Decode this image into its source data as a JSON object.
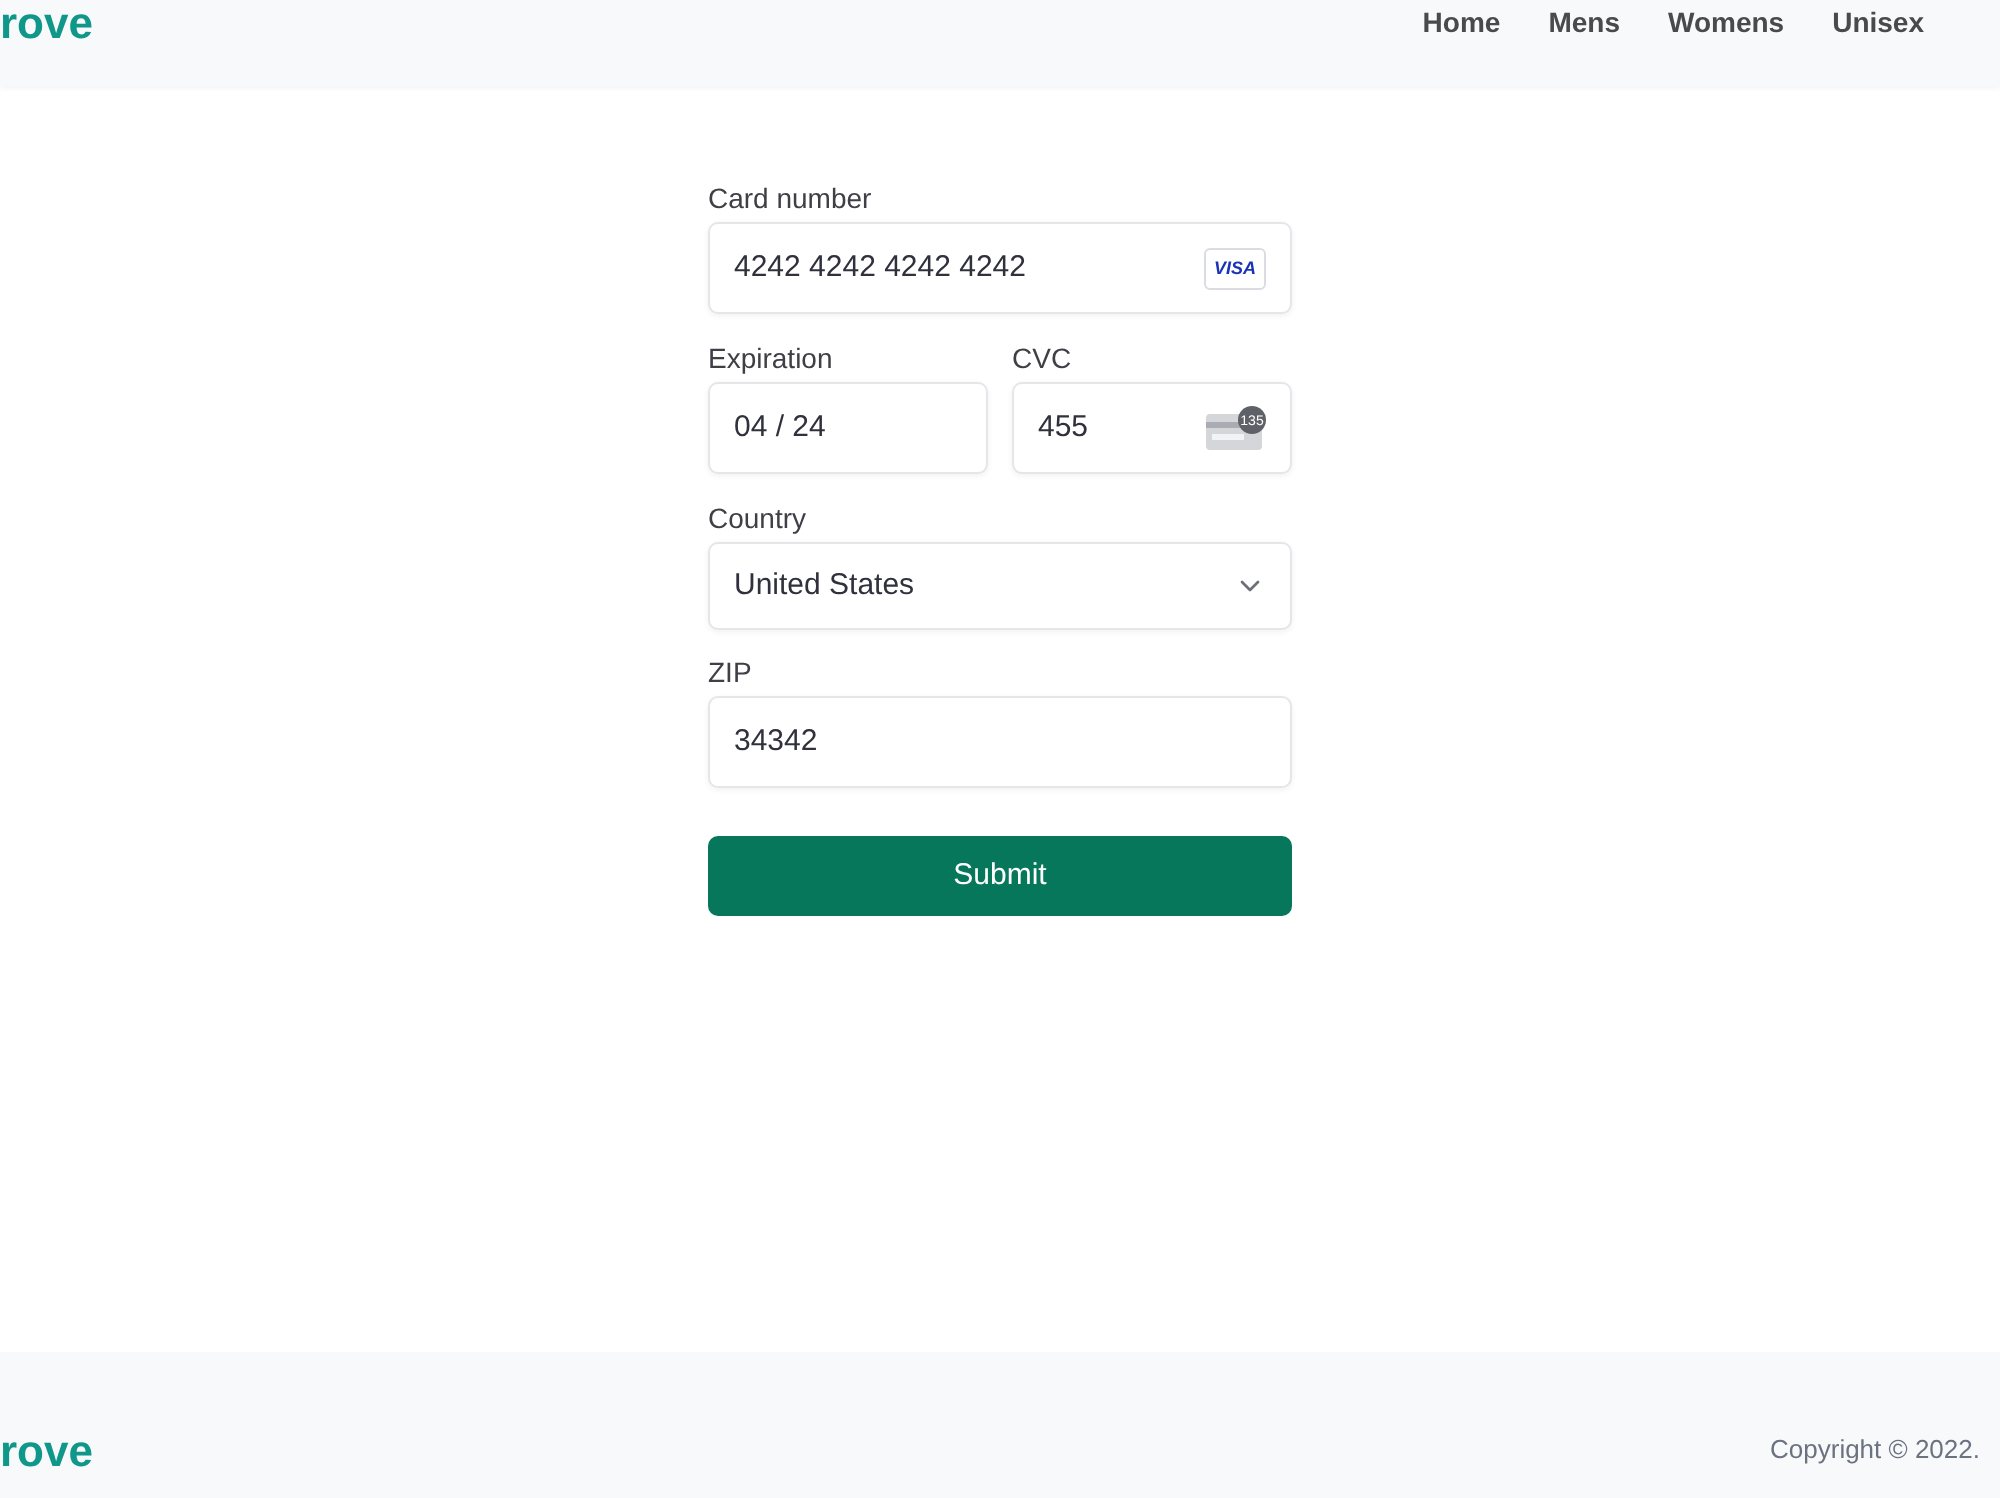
{
  "header": {
    "logo": "rove",
    "nav": [
      "Home",
      "Mens",
      "Womens",
      "Unisex"
    ]
  },
  "form": {
    "card_number": {
      "label": "Card number",
      "value": "4242 4242 4242 4242",
      "brand": "VISA"
    },
    "expiration": {
      "label": "Expiration",
      "value": "04 / 24"
    },
    "cvc": {
      "label": "CVC",
      "value": "455",
      "hint": "135"
    },
    "country": {
      "label": "Country",
      "value": "United States"
    },
    "zip": {
      "label": "ZIP",
      "value": "34342"
    },
    "submit": "Submit"
  },
  "footer": {
    "logo": "rove",
    "copyright": "Copyright © 2022."
  }
}
